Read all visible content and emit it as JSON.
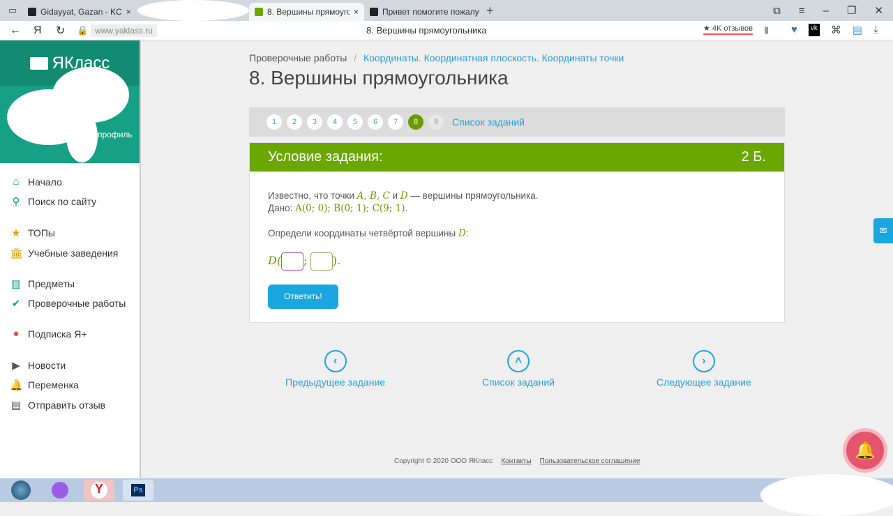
{
  "browser": {
    "tabs": [
      {
        "label": "Gidayyat, Gazan - KC"
      },
      {
        "label": "8. Вершины прямоугольника"
      },
      {
        "label": "Привет помогите пожалуй"
      }
    ],
    "url": "www.yaklass.ru",
    "page_title": "8. Вершины прямоугольника",
    "reviews": "★ 4K отзывов",
    "new_tab": "+"
  },
  "sidebar": {
    "logo": "ЯКласс",
    "profile_fragment": "профиль",
    "items": [
      {
        "label": "Начало"
      },
      {
        "label": "Поиск по сайту"
      },
      {
        "label": "ТОПы"
      },
      {
        "label": "Учебные заведения"
      },
      {
        "label": "Предметы"
      },
      {
        "label": "Проверочные работы"
      },
      {
        "label": "Подписка Я+"
      },
      {
        "label": "Новости"
      },
      {
        "label": "Переменка"
      },
      {
        "label": "Отправить отзыв"
      }
    ]
  },
  "breadcrumb": {
    "root": "Проверочные работы",
    "section": "Координаты. Координатная плоскость. Координаты точки"
  },
  "title": "8. Вершины прямоугольника",
  "pager": {
    "pages": [
      "1",
      "2",
      "3",
      "4",
      "5",
      "6",
      "7",
      "8",
      "9"
    ],
    "current": "8",
    "list_label": "Список заданий"
  },
  "task": {
    "header": "Условие задания:",
    "points": "2 Б.",
    "line1_pre": "Известно, что точки ",
    "vars": "A, B, C",
    "and": " и ",
    "varD": "D",
    "line1_post": " — вершины прямоугольника.",
    "given_label": "Дано: ",
    "given": "A(0; 0); B(0; 1); C(9; 1)",
    "dot": ".",
    "question": "Определи координаты четвёртой вершины ",
    "question_end": ":",
    "answer_prefix": "D(",
    "sep": ";",
    "answer_suffix": ").",
    "answer_x": "",
    "answer_y": "",
    "submit": "Ответить!"
  },
  "bottom_nav": {
    "prev": "Предыдущее задание",
    "list": "Список заданий",
    "next": "Следующее задание"
  },
  "footer": {
    "copyright": "Copyright © 2020 ООО ЯКласс",
    "contacts": "Контакты",
    "agreement": "Пользовательское соглашение"
  }
}
